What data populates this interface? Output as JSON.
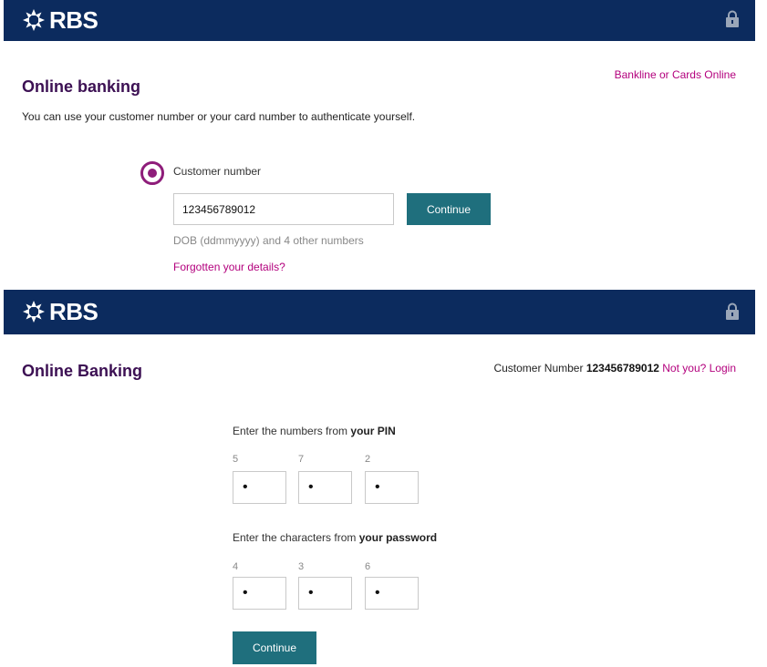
{
  "colors": {
    "header_bg": "#0c2b5e",
    "title": "#3c1053",
    "link": "#b3007d",
    "button_bg": "#1f6f7d",
    "radio": "#8e1d7a"
  },
  "top_panel": {
    "logo_text": "RBS",
    "logo_icon": "rbs-daisy-wheel-icon",
    "lock_icon": "padlock-icon",
    "title": "Online banking",
    "bankline_link": "Bankline or Cards Online",
    "intro": "You can use your customer number or your card number to authenticate yourself.",
    "radio_label": "Customer number",
    "customer_number_value": "123456789012",
    "continue_label": "Continue",
    "hint": "DOB (ddmmyyyy) and 4 other numbers",
    "forgot_link": "Forgotten your details?"
  },
  "bottom_panel": {
    "logo_text": "RBS",
    "logo_icon": "rbs-daisy-wheel-icon",
    "lock_icon": "padlock-icon",
    "title": "Online Banking",
    "customer_number_label": "Customer Number",
    "customer_number_value": "123456789012",
    "not_you_link": "Not you? Login",
    "pin_prompt": "Enter the numbers from",
    "pin_prompt_bold": "your PIN",
    "pin_positions": [
      "5",
      "7",
      "2"
    ],
    "pin_values": [
      "•",
      "•",
      "•"
    ],
    "password_prompt": "Enter the characters from",
    "password_prompt_bold": "your password",
    "password_positions": [
      "4",
      "3",
      "6"
    ],
    "password_values": [
      "•",
      "•",
      "•"
    ],
    "continue_label": "Continue"
  }
}
